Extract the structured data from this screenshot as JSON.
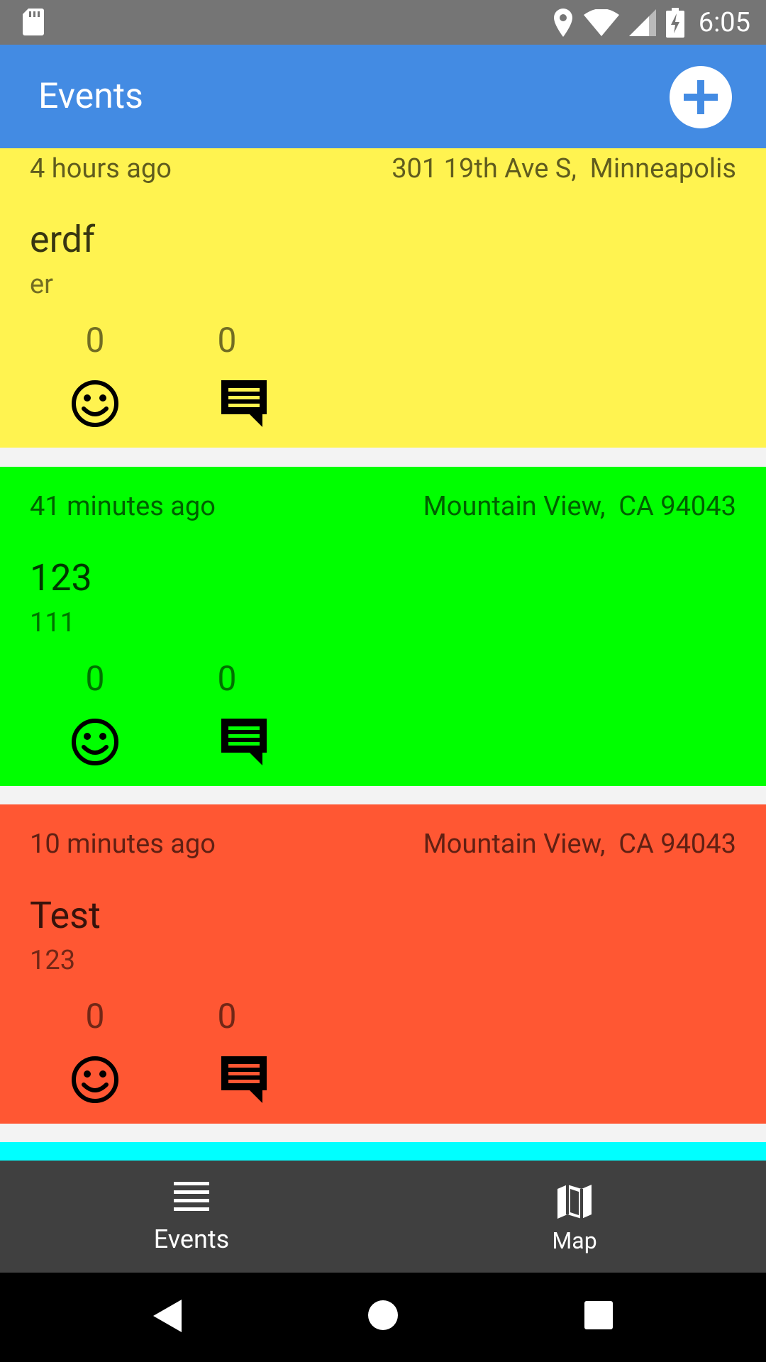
{
  "status_bar": {
    "time": "6:05"
  },
  "app_bar": {
    "title": "Events",
    "add_icon": "plus-circle-icon"
  },
  "events": [
    {
      "time": "4 hours ago",
      "location": "301 19th Ave S,  Minneapolis",
      "title": "erdf",
      "description": "er",
      "likes": "0",
      "comments": "0",
      "color": "#fff350"
    },
    {
      "time": "41 minutes ago",
      "location": "Mountain View,  CA 94043",
      "title": "123",
      "description": "111",
      "likes": "0",
      "comments": "0",
      "color": "#00ff00"
    },
    {
      "time": "10 minutes ago",
      "location": "Mountain View,  CA 94043",
      "title": "Test",
      "description": "123",
      "likes": "0",
      "comments": "0",
      "color": "#ff5733"
    }
  ],
  "partial_card_color": "#00ffff",
  "bottom_nav": {
    "events_label": "Events",
    "map_label": "Map",
    "events_icon": "list-icon",
    "map_icon": "map-icon"
  },
  "colors": {
    "app_bar": "#438be3",
    "status_bar": "#757575",
    "bottom_nav": "#404040"
  }
}
